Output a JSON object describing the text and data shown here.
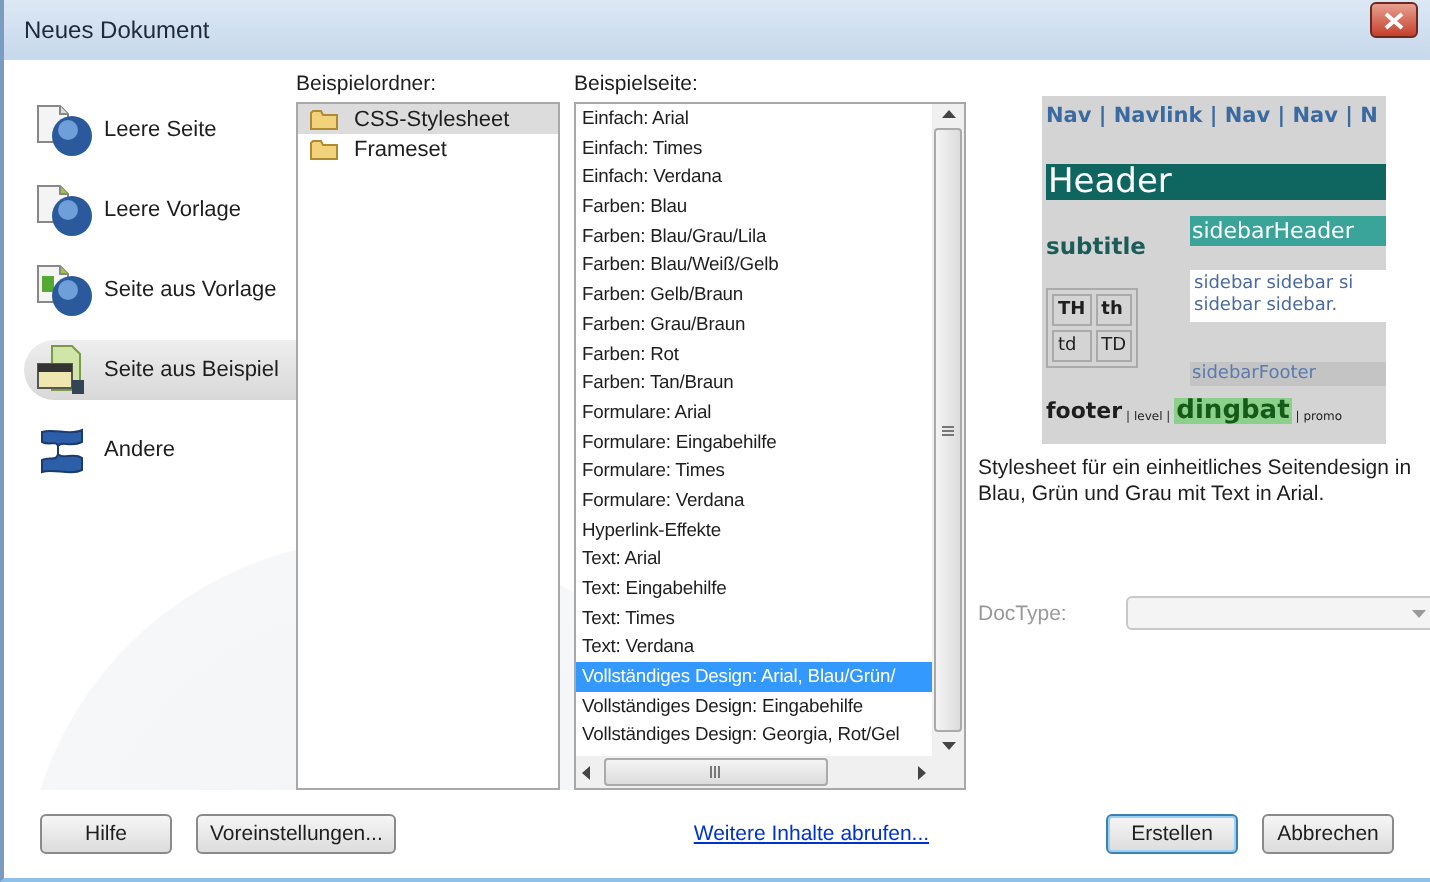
{
  "window": {
    "title": "Neues Dokument"
  },
  "categories": [
    {
      "label": "Leere Seite",
      "kind": "blank-page",
      "selected": false
    },
    {
      "label": "Leere Vorlage",
      "kind": "blank-template",
      "selected": false
    },
    {
      "label": "Seite aus Vorlage",
      "kind": "page-from-template",
      "selected": false
    },
    {
      "label": "Seite aus Beispiel",
      "kind": "page-from-sample",
      "selected": true
    },
    {
      "label": "Andere",
      "kind": "other",
      "selected": false
    }
  ],
  "folders": {
    "label": "Beispielordner:",
    "items": [
      {
        "label": "CSS-Stylesheet",
        "selected": true
      },
      {
        "label": "Frameset",
        "selected": false
      }
    ]
  },
  "pages": {
    "label": "Beispielseite:",
    "items": [
      {
        "label": "Einfach: Arial",
        "selected": false
      },
      {
        "label": "Einfach: Times",
        "selected": false
      },
      {
        "label": "Einfach: Verdana",
        "selected": false
      },
      {
        "label": "Farben: Blau",
        "selected": false
      },
      {
        "label": "Farben: Blau/Grau/Lila",
        "selected": false
      },
      {
        "label": "Farben: Blau/Weiß/Gelb",
        "selected": false
      },
      {
        "label": "Farben: Gelb/Braun",
        "selected": false
      },
      {
        "label": "Farben: Grau/Braun",
        "selected": false
      },
      {
        "label": "Farben: Rot",
        "selected": false
      },
      {
        "label": "Farben: Tan/Braun",
        "selected": false
      },
      {
        "label": "Formulare: Arial",
        "selected": false
      },
      {
        "label": "Formulare: Eingabehilfe",
        "selected": false
      },
      {
        "label": "Formulare: Times",
        "selected": false
      },
      {
        "label": "Formulare: Verdana",
        "selected": false
      },
      {
        "label": "Hyperlink-Effekte",
        "selected": false
      },
      {
        "label": "Text: Arial",
        "selected": false
      },
      {
        "label": "Text: Eingabehilfe",
        "selected": false
      },
      {
        "label": "Text: Times",
        "selected": false
      },
      {
        "label": "Text: Verdana",
        "selected": false
      },
      {
        "label": "Vollständiges Design: Arial, Blau/Grün/",
        "selected": true
      },
      {
        "label": "Vollständiges Design: Eingabehilfe",
        "selected": false
      },
      {
        "label": "Vollständiges Design: Georgia, Rot/Gel",
        "selected": false
      }
    ]
  },
  "preview": {
    "nav": "Nav | Navlink | Nav | Nav | N",
    "header": "Header",
    "subtitle": "subtitle",
    "sidebar_header": "sidebarHeader",
    "sidebar_text": "sidebar sidebar si sidebar sidebar.",
    "table": [
      [
        "TH",
        "th"
      ],
      [
        "td",
        "TD"
      ]
    ],
    "sidebar_footer": "sidebarFooter",
    "footer": "footer",
    "footer_link": "| level |",
    "dingbat": "dingbat",
    "promo": "| promo"
  },
  "description": "Stylesheet für ein einheitliches Seitendesign in Blau, Grün und Grau mit Text in Arial.",
  "doctype": {
    "label": "DocType:"
  },
  "buttons_left": [
    "Hilfe",
    "Voreinstellungen..."
  ],
  "link": "Weitere Inhalte abrufen...",
  "buttons_right": [
    {
      "label": "Erstellen",
      "default": true
    },
    {
      "label": "Abbrechen",
      "default": false
    }
  ]
}
